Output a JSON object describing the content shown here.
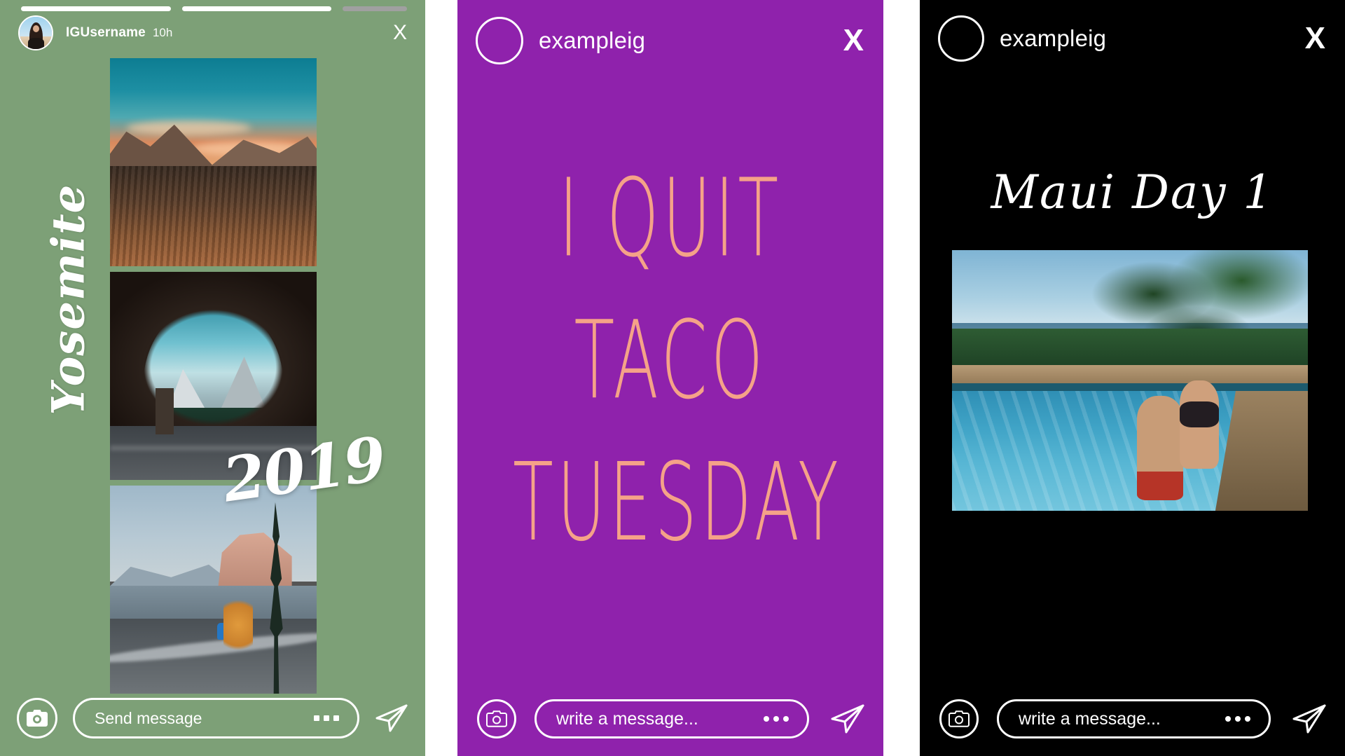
{
  "page": {
    "title": "Instagram Stories Examples",
    "background": "#ffffff"
  },
  "panels": [
    {
      "id": "yosemite",
      "background_color": "#7da077",
      "progress": {
        "segments": 3,
        "states": [
          "filled",
          "filled",
          "dim"
        ]
      },
      "header": {
        "avatar_name": "user-avatar-photo",
        "username": "IGUsername",
        "timestamp": "10h",
        "close_label": "X"
      },
      "overlay": {
        "title": "Yosemite",
        "year": "2019"
      },
      "photos": [
        {
          "name": "yosemite-valley-sunset"
        },
        {
          "name": "yosemite-tunnel-view"
        },
        {
          "name": "yosemite-half-dome-road"
        }
      ],
      "footer": {
        "camera_icon": "camera-icon",
        "input_placeholder": "Send message",
        "more_icon": "more-dots-icon",
        "send_icon": "send-paper-plane-icon"
      }
    },
    {
      "id": "taco",
      "background_color": "#8f22ac",
      "text_color": "#f5a288",
      "header": {
        "avatar_name": "empty-circle-avatar",
        "username": "exampleig",
        "close_label": "X"
      },
      "overlay": {
        "line1": "I QUIT",
        "line2": "TACO",
        "line3": "TUESDAY",
        "full_text": "I QUIT\nTACO\nTUESDAY"
      },
      "footer": {
        "camera_icon": "camera-icon",
        "input_placeholder": "write a message...",
        "more_icon": "more-dots-icon",
        "send_icon": "send-paper-plane-icon"
      }
    },
    {
      "id": "maui",
      "background_color": "#000000",
      "header": {
        "avatar_name": "empty-circle-avatar",
        "username": "exampleig",
        "close_label": "X"
      },
      "overlay": {
        "title": "Maui Day 1"
      },
      "photos": [
        {
          "name": "maui-pool-couple"
        }
      ],
      "footer": {
        "camera_icon": "camera-icon",
        "input_placeholder": "write a message...",
        "more_icon": "more-dots-icon",
        "send_icon": "send-paper-plane-icon"
      }
    }
  ]
}
